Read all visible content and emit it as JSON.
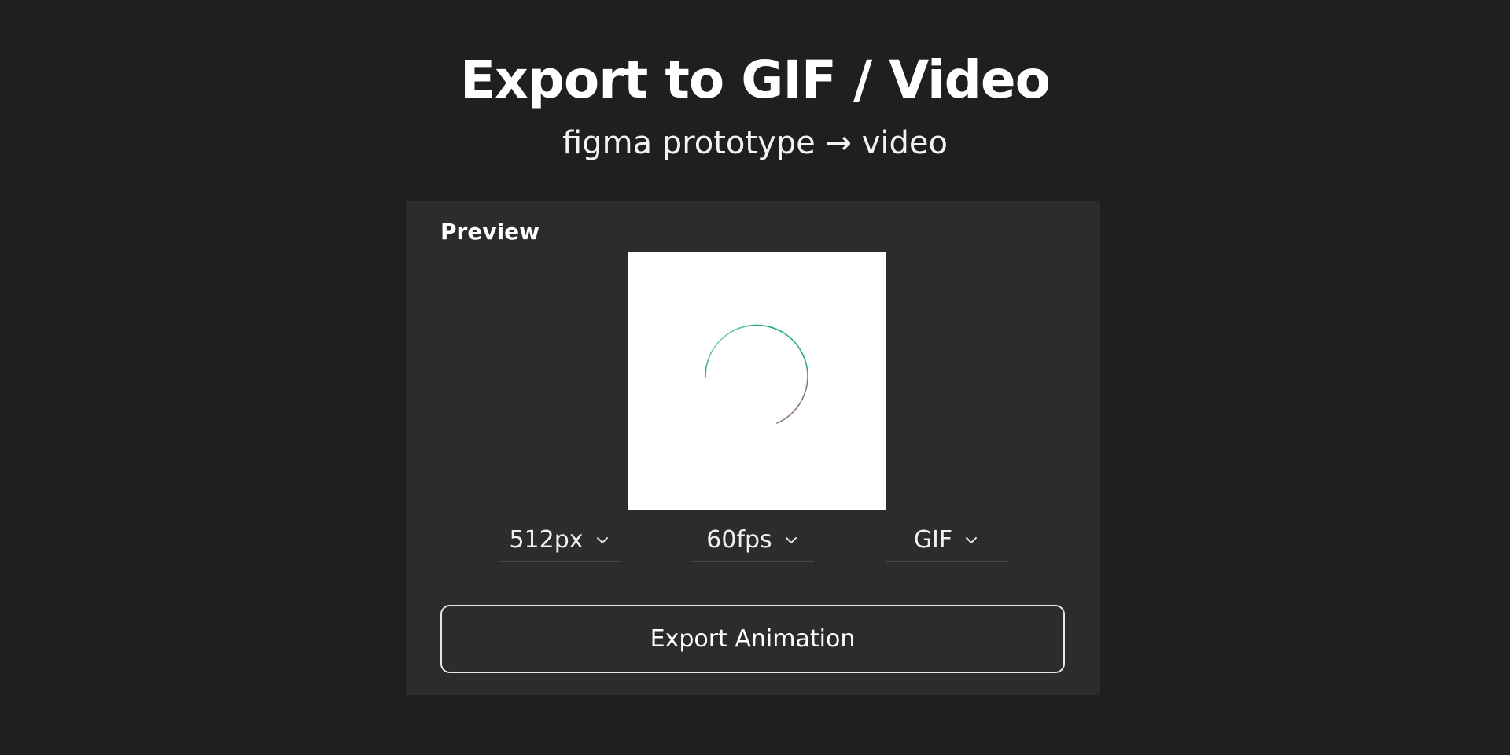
{
  "hero": {
    "title": "Export to GIF / Video",
    "subtitle": "figma prototype → video"
  },
  "panel": {
    "label": "Preview",
    "preview": {
      "background": "#ffffff",
      "spinner_colors": [
        "#19a97b",
        "#e8436d"
      ]
    },
    "selects": [
      {
        "value": "512px",
        "icon": "chevron-down-icon"
      },
      {
        "value": "60fps",
        "icon": "chevron-down-icon"
      },
      {
        "value": "GIF",
        "icon": "chevron-down-icon"
      }
    ],
    "export_button": {
      "label": "Export Animation"
    }
  },
  "colors": {
    "page_background": "#1f1f1f",
    "panel_background": "#2c2c2c",
    "divider": "#4a4a4a",
    "button_border": "#e6e6e6",
    "text": "#ffffff"
  }
}
